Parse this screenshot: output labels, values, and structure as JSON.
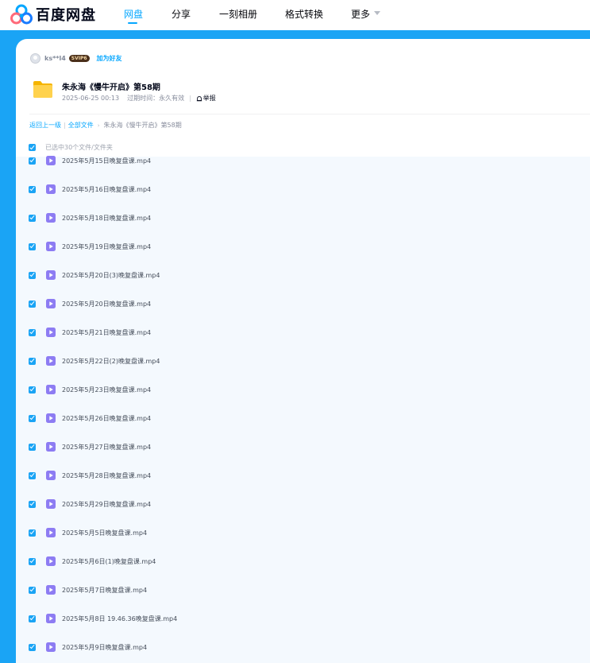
{
  "brand": {
    "name": "百度网盘",
    "logo_icon": "baidu-netdisk-logo"
  },
  "nav": {
    "items": [
      {
        "label": "网盘",
        "active": true
      },
      {
        "label": "分享",
        "active": false
      },
      {
        "label": "一刻相册",
        "active": false
      },
      {
        "label": "格式转换",
        "active": false
      },
      {
        "label": "更多",
        "active": false,
        "has_dropdown": true
      }
    ]
  },
  "share": {
    "user_name": "ks**l4",
    "vip_label": "SVIP6",
    "add_friend": "加为好友",
    "title": "朱永海《慢牛开启》第58期",
    "date": "2025-06-25 00:13",
    "expiry_label": "过期时间：永久有效",
    "report_label": "举报"
  },
  "breadcrumb": {
    "back": "返回上一级",
    "all_files": "全部文件",
    "current": "朱永海《慢牛开启》第58期"
  },
  "selection": {
    "text": "已选中30个文件/文件夹"
  },
  "files": [
    "2025年5月15日晚复盘课.mp4",
    "2025年5月16日晚复盘课.mp4",
    "2025年5月18日晚复盘课.mp4",
    "2025年5月19日晚复盘课.mp4",
    "2025年5月20日(3)晚复盘课.mp4",
    "2025年5月20日晚复盘课.mp4",
    "2025年5月21日晚复盘课.mp4",
    "2025年5月22日(2)晚复盘课.mp4",
    "2025年5月23日晚复盘课.mp4",
    "2025年5月26日晚复盘课.mp4",
    "2025年5月27日晚复盘课.mp4",
    "2025年5月28日晚复盘课.mp4",
    "2025年5月29日晚复盘课.mp4",
    "2025年5月5日晚复盘课.mp4",
    "2025年5月6日(1)晚复盘课.mp4",
    "2025年5月7日晚复盘课.mp4",
    "2025年5月8日 19.46.36晚复盘课.mp4",
    "2025年5月9日晚复盘课.mp4"
  ],
  "colors": {
    "accent": "#06a7ff",
    "frame": "#1aa4f5",
    "list_bg": "#f4f9fe"
  }
}
